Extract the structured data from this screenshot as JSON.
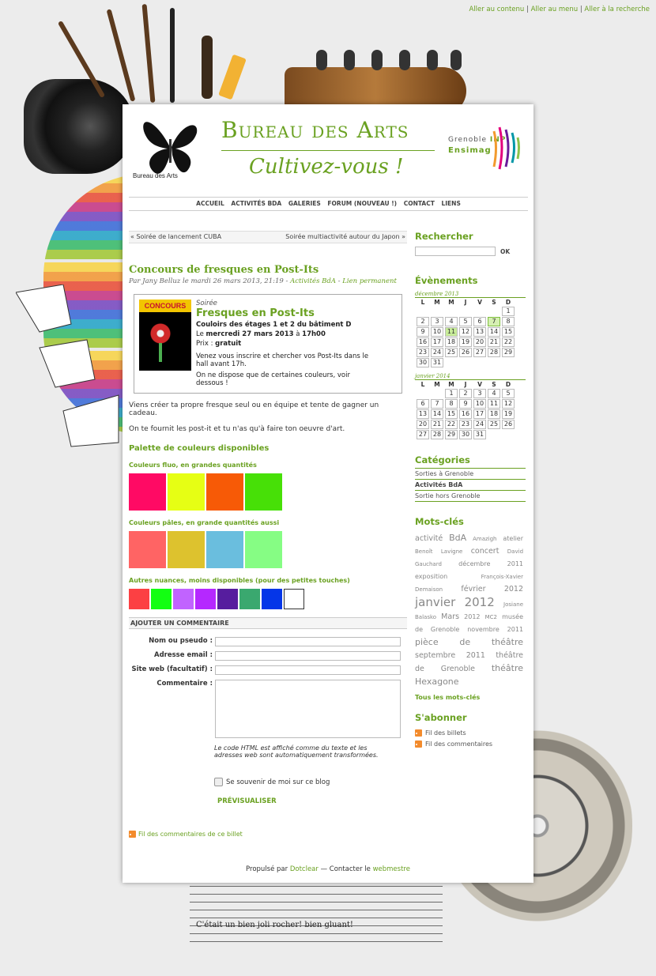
{
  "skip_links": {
    "content": "Aller au contenu",
    "menu": "Aller au menu",
    "search": "Aller à la recherche",
    "sep": "|"
  },
  "header": {
    "site_title": "Bureau des Arts",
    "tagline": "Cultivez-vous !",
    "logo_label": "Bureau des Arts",
    "inp_grenoble": "Grenoble",
    "inp_inp": "INP",
    "inp_ensimag": "Ensimag"
  },
  "nav": {
    "items": [
      "ACCUEIL",
      "ACTIVITÉS BDA",
      "GALERIES",
      "FORUM (NOUVEAU !)",
      "CONTACT",
      "LIENS"
    ]
  },
  "post_nav": {
    "prev": "« Soirée de lancement CUBA",
    "next": "Soirée multiactivité autour du Japon »"
  },
  "post": {
    "title": "Concours de fresques en Post-Its",
    "meta_prefix": "Par Jany Belluz le mardi 26 mars 2013, 21:19 -",
    "meta_category": "Activités BdA",
    "meta_sep": "-",
    "meta_permalink": "Lien permanent",
    "event": {
      "poster_title": "CONCOURS",
      "type": "Soirée",
      "title": "Fresques en Post-Its",
      "location": "Couloirs des étages 1 et 2 du bâtiment D",
      "date_prefix": "Le",
      "date": "mercredi 27 mars 2013",
      "date_mid": "à",
      "time": "17h00",
      "price_label": "Prix :",
      "price": "gratuit",
      "note1": "Venez vous inscrire et chercher vos Post-Its dans le hall avant 17h.",
      "note2": "On ne dispose que de certaines couleurs, voir dessous !"
    },
    "para1": "Viens créer ta propre fresque seul ou en équipe et tente de gagner un cadeau.",
    "para2": "On te fournit les post-it et tu n'as qu'à faire ton oeuvre d'art.",
    "palette_heading": "Palette de couleurs disponibles",
    "fluo_heading": "Couleurs fluo, en grandes quantités",
    "fluo_colors": [
      "#ff0a64",
      "#e6ff14",
      "#f75a06",
      "#47e007"
    ],
    "pale_heading": "Couleurs pâles, en grande quantités aussi",
    "pale_colors": [
      "#ff6464",
      "#ddc22e",
      "#6abede",
      "#86fd84"
    ],
    "other_heading": "Autres nuances, moins disponibles (pour des petites touches)",
    "other_colors": [
      "#fc4043",
      "#13ff12",
      "#c163ff",
      "#b528ff",
      "#561d9e",
      "#3aa86f",
      "#0536e8",
      "#ffffff"
    ]
  },
  "comments": {
    "heading": "AJOUTER UN COMMENTAIRE",
    "name_label": "Nom ou pseudo :",
    "email_label": "Adresse email :",
    "site_label": "Site web (facultatif) :",
    "comment_label": "Commentaire :",
    "html_note": "Le code HTML est affiché comme du texte et les adresses web sont automatiquement transformées.",
    "remember": "Se souvenir de moi sur ce blog",
    "preview": "PRÉVISUALISER",
    "feed": "Fil des commentaires de ce billet"
  },
  "footer": {
    "prefix": "Propulsé par",
    "dotclear": "Dotclear",
    "mid": "— Contacter le",
    "webmaster": "webmestre"
  },
  "sidebar": {
    "search_heading": "Rechercher",
    "search_button": "OK",
    "events_heading": "Évènements",
    "weekdays": [
      "L",
      "M",
      "M",
      "J",
      "V",
      "S",
      "D"
    ],
    "cal1_month": "décembre 2013",
    "cal1_weeks": [
      [
        "",
        "",
        "",
        "",
        "",
        "",
        "1"
      ],
      [
        "2",
        "3",
        "4",
        "5",
        "6",
        "7",
        "8"
      ],
      [
        "9",
        "10",
        "11",
        "12",
        "13",
        "14",
        "15"
      ],
      [
        "16",
        "17",
        "18",
        "19",
        "20",
        "21",
        "22"
      ],
      [
        "23",
        "24",
        "25",
        "26",
        "27",
        "28",
        "29"
      ],
      [
        "30",
        "31",
        "",
        "",
        "",
        "",
        ""
      ]
    ],
    "cal2_month": "janvier 2014",
    "cal2_weeks": [
      [
        "",
        "",
        "1",
        "2",
        "3",
        "4",
        "5"
      ],
      [
        "6",
        "7",
        "8",
        "9",
        "10",
        "11",
        "12"
      ],
      [
        "13",
        "14",
        "15",
        "16",
        "17",
        "18",
        "19"
      ],
      [
        "20",
        "21",
        "22",
        "23",
        "24",
        "25",
        "26"
      ],
      [
        "27",
        "28",
        "29",
        "30",
        "31",
        "",
        ""
      ]
    ],
    "categories_heading": "Catégories",
    "categories": [
      "Sorties à Grenoble",
      "Activités BdA",
      "Sortie hors Grenoble"
    ],
    "tags_heading": "Mots-clés",
    "tags": [
      {
        "t": "activité",
        "s": 3
      },
      {
        "t": "BdA",
        "s": 4
      },
      {
        "t": "Amazigh",
        "s": 1
      },
      {
        "t": "atelier",
        "s": 2
      },
      {
        "t": "Benoît",
        "s": 1
      },
      {
        "t": "Lavigne",
        "s": 1
      },
      {
        "t": "concert",
        "s": 3
      },
      {
        "t": "David",
        "s": 1
      },
      {
        "t": "Gauchard",
        "s": 1
      },
      {
        "t": "décembre",
        "s": 2
      },
      {
        "t": "2011",
        "s": 2
      },
      {
        "t": "exposition",
        "s": 2
      },
      {
        "t": "François-Xavier",
        "s": 1
      },
      {
        "t": "Demaison",
        "s": 1
      },
      {
        "t": "février",
        "s": 3
      },
      {
        "t": "2012",
        "s": 3
      },
      {
        "t": "janvier",
        "s": 5
      },
      {
        "t": "2012",
        "s": 5
      },
      {
        "t": "Josiane",
        "s": 1
      },
      {
        "t": "Balasko",
        "s": 1
      },
      {
        "t": "Mars",
        "s": 3
      },
      {
        "t": "2012",
        "s": 2
      },
      {
        "t": "MC2",
        "s": 1
      },
      {
        "t": "musée",
        "s": 2
      },
      {
        "t": "de",
        "s": 2
      },
      {
        "t": "Grenoble",
        "s": 2
      },
      {
        "t": "novembre",
        "s": 2
      },
      {
        "t": "2011",
        "s": 2
      },
      {
        "t": "pièce",
        "s": 4
      },
      {
        "t": "de",
        "s": 4
      },
      {
        "t": "théâtre",
        "s": 4
      },
      {
        "t": "septembre",
        "s": 3
      },
      {
        "t": "2011",
        "s": 3
      },
      {
        "t": "théâtre",
        "s": 3
      },
      {
        "t": "de",
        "s": 3
      },
      {
        "t": "Grenoble",
        "s": 3
      },
      {
        "t": "théâtre",
        "s": 4
      },
      {
        "t": "Hexagone",
        "s": 4
      }
    ],
    "all_tags": "Tous les mots-clés",
    "subscribe_heading": "S'abonner",
    "feed_posts": "Fil des billets",
    "feed_comments": "Fil des commentaires"
  },
  "decor": {
    "sheet_lyrics": "C'était un bien joli rocher! bien gluant!"
  },
  "colors": {
    "accent": "#6aa121",
    "today": "#c8ec9a"
  }
}
